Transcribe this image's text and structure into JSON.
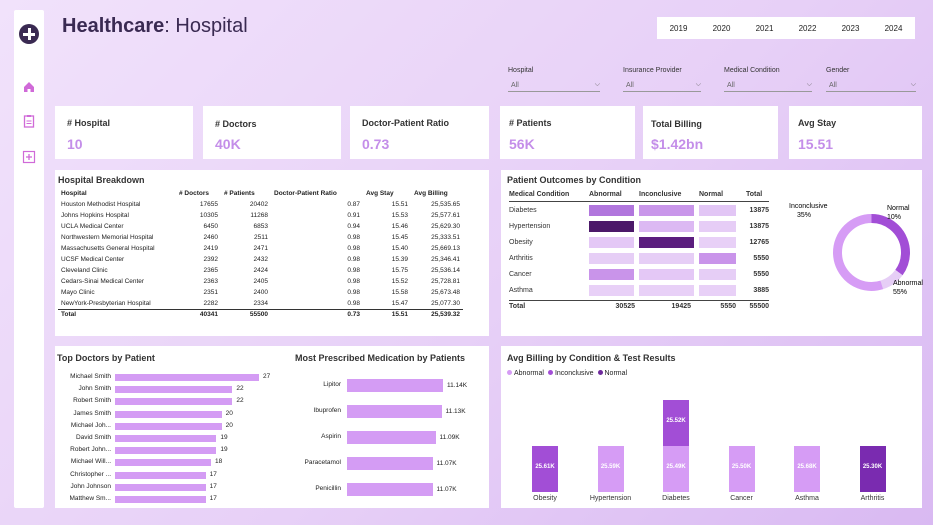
{
  "header": {
    "title_bold": "Healthcare",
    "title_rest": ": Hospital"
  },
  "years": [
    "2019",
    "2020",
    "2021",
    "2022",
    "2023",
    "2024"
  ],
  "slicers": [
    {
      "label": "Hospital",
      "value": "All"
    },
    {
      "label": "Insurance Provider",
      "value": "All"
    },
    {
      "label": "Medical Condition",
      "value": "All"
    },
    {
      "label": "Gender",
      "value": "All"
    }
  ],
  "kpis": [
    {
      "label": "# Hospital",
      "value": "10"
    },
    {
      "label": "# Doctors",
      "value": "40K"
    },
    {
      "label": "Doctor-Patient Ratio",
      "value": "0.73"
    },
    {
      "label": "# Patients",
      "value": "56K"
    },
    {
      "label": "Total Billing",
      "value": "$1.42bn"
    },
    {
      "label": "Avg Stay",
      "value": "15.51"
    }
  ],
  "hospital_breakdown": {
    "title": "Hospital Breakdown",
    "columns": [
      "Hospital",
      "# Doctors",
      "# Patients",
      "Doctor-Patient Ratio",
      "Avg Stay",
      "Avg Billing"
    ],
    "rows": [
      [
        "Houston Methodist Hospital",
        "17655",
        "20402",
        "0.87",
        "15.51",
        "25,535.65"
      ],
      [
        "Johns Hopkins Hospital",
        "10305",
        "11268",
        "0.91",
        "15.53",
        "25,577.61"
      ],
      [
        "UCLA Medical Center",
        "6450",
        "6853",
        "0.94",
        "15.46",
        "25,629.30"
      ],
      [
        "Northwestern Memorial Hospital",
        "2460",
        "2511",
        "0.98",
        "15.45",
        "25,333.51"
      ],
      [
        "Massachusetts General Hospital",
        "2419",
        "2471",
        "0.98",
        "15.40",
        "25,669.13"
      ],
      [
        "UCSF Medical Center",
        "2392",
        "2432",
        "0.98",
        "15.39",
        "25,346.41"
      ],
      [
        "Cleveland Clinic",
        "2365",
        "2424",
        "0.98",
        "15.75",
        "25,536.14"
      ],
      [
        "Cedars-Sinai Medical Center",
        "2363",
        "2405",
        "0.98",
        "15.52",
        "25,728.81"
      ],
      [
        "Mayo Clinic",
        "2351",
        "2400",
        "0.98",
        "15.58",
        "25,673.48"
      ],
      [
        "NewYork-Presbyterian Hospital",
        "2282",
        "2334",
        "0.98",
        "15.47",
        "25,077.30"
      ]
    ],
    "total": [
      "Total",
      "40341",
      "55500",
      "0.73",
      "15.51",
      "25,539.32"
    ]
  },
  "outcomes": {
    "title": "Patient Outcomes by Condition",
    "columns": [
      "Medical Condition",
      "Abnormal",
      "Inconclusive",
      "Normal",
      "Total"
    ],
    "rows": [
      {
        "name": "Diabetes",
        "total": "13875",
        "shades": [
          "#b176dd",
          "#c996ea",
          "#e2c6f5"
        ]
      },
      {
        "name": "Hypertension",
        "total": "13875",
        "shades": [
          "#4b1869",
          "#dcb9f3",
          "#e6cdf6"
        ]
      },
      {
        "name": "Obesity",
        "total": "12765",
        "shades": [
          "#e4c8f6",
          "#5b1e7e",
          "#e8d0f7"
        ]
      },
      {
        "name": "Arthritis",
        "total": "5550",
        "shades": [
          "#e6cef6",
          "#e6cef6",
          "#c994ea"
        ]
      },
      {
        "name": "Cancer",
        "total": "5550",
        "shades": [
          "#c994ea",
          "#e4c8f6",
          "#e6cef6"
        ]
      },
      {
        "name": "Asthma",
        "total": "3885",
        "shades": [
          "#e8d0f7",
          "#e8d0f7",
          "#e8d0f7"
        ]
      }
    ],
    "total": [
      "Total",
      "30525",
      "19425",
      "5550",
      "55500"
    ],
    "donut": [
      {
        "name": "Inconclusive",
        "pct": "35%",
        "value": 35,
        "color": "#a24ed6"
      },
      {
        "name": "Normal",
        "pct": "10%",
        "value": 10,
        "color": "#e6cef6"
      },
      {
        "name": "Abnormal",
        "pct": "55%",
        "value": 55,
        "color": "#d69cf5"
      }
    ]
  },
  "top_doctors": {
    "title": "Top Doctors by Patient",
    "rows": [
      {
        "name": "Michael Smith",
        "value": 27
      },
      {
        "name": "John Smith",
        "value": 22
      },
      {
        "name": "Robert Smith",
        "value": 22
      },
      {
        "name": "James Smith",
        "value": 20
      },
      {
        "name": "Michael Joh...",
        "value": 20
      },
      {
        "name": "David Smith",
        "value": 19
      },
      {
        "name": "Robert John...",
        "value": 19
      },
      {
        "name": "Michael Will...",
        "value": 18
      },
      {
        "name": "Christopher ...",
        "value": 17
      },
      {
        "name": "John Johnson",
        "value": 17
      },
      {
        "name": "Matthew Sm...",
        "value": 17
      }
    ]
  },
  "medication": {
    "title": "Most Prescribed Medication by  Patients",
    "rows": [
      {
        "name": "Lipitor",
        "value": 11.14,
        "label": "11.14K"
      },
      {
        "name": "Ibuprofen",
        "value": 11.13,
        "label": "11.13K"
      },
      {
        "name": "Aspirin",
        "value": 11.09,
        "label": "11.09K"
      },
      {
        "name": "Paracetamol",
        "value": 11.07,
        "label": "11.07K"
      },
      {
        "name": "Penicillin",
        "value": 11.07,
        "label": "11.07K"
      }
    ]
  },
  "chart_data": {
    "type": "bar",
    "title": "Avg Billing by Condition & Test Results",
    "legend": [
      "Abnormal",
      "Inconclusive",
      "Normal"
    ],
    "legend_colors": [
      "#d69cf5",
      "#a24ed6",
      "#6e2a9c"
    ],
    "categories": [
      "Obesity",
      "Hypertension",
      "Diabetes",
      "Cancer",
      "Asthma",
      "Arthritis"
    ],
    "bars": [
      {
        "category": "Obesity",
        "segments": [
          {
            "label": "25.61K",
            "color": "#a24ed6",
            "value": 25.61
          }
        ]
      },
      {
        "category": "Hypertension",
        "segments": [
          {
            "label": "25.59K",
            "color": "#d69cf5",
            "value": 25.59
          }
        ]
      },
      {
        "category": "Diabetes",
        "segments": [
          {
            "label": "25.49K",
            "color": "#d69cf5",
            "value": 25.49
          },
          {
            "label": "25.52K",
            "color": "#a24ed6",
            "value": 25.52
          }
        ]
      },
      {
        "category": "Cancer",
        "segments": [
          {
            "label": "25.50K",
            "color": "#d69cf5",
            "value": 25.5
          }
        ]
      },
      {
        "category": "Asthma",
        "segments": [
          {
            "label": "25.68K",
            "color": "#d69cf5",
            "value": 25.68
          }
        ]
      },
      {
        "category": "Arthritis",
        "segments": [
          {
            "label": "25.30K",
            "color": "#7a2bb0",
            "value": 25.3
          }
        ]
      }
    ]
  }
}
